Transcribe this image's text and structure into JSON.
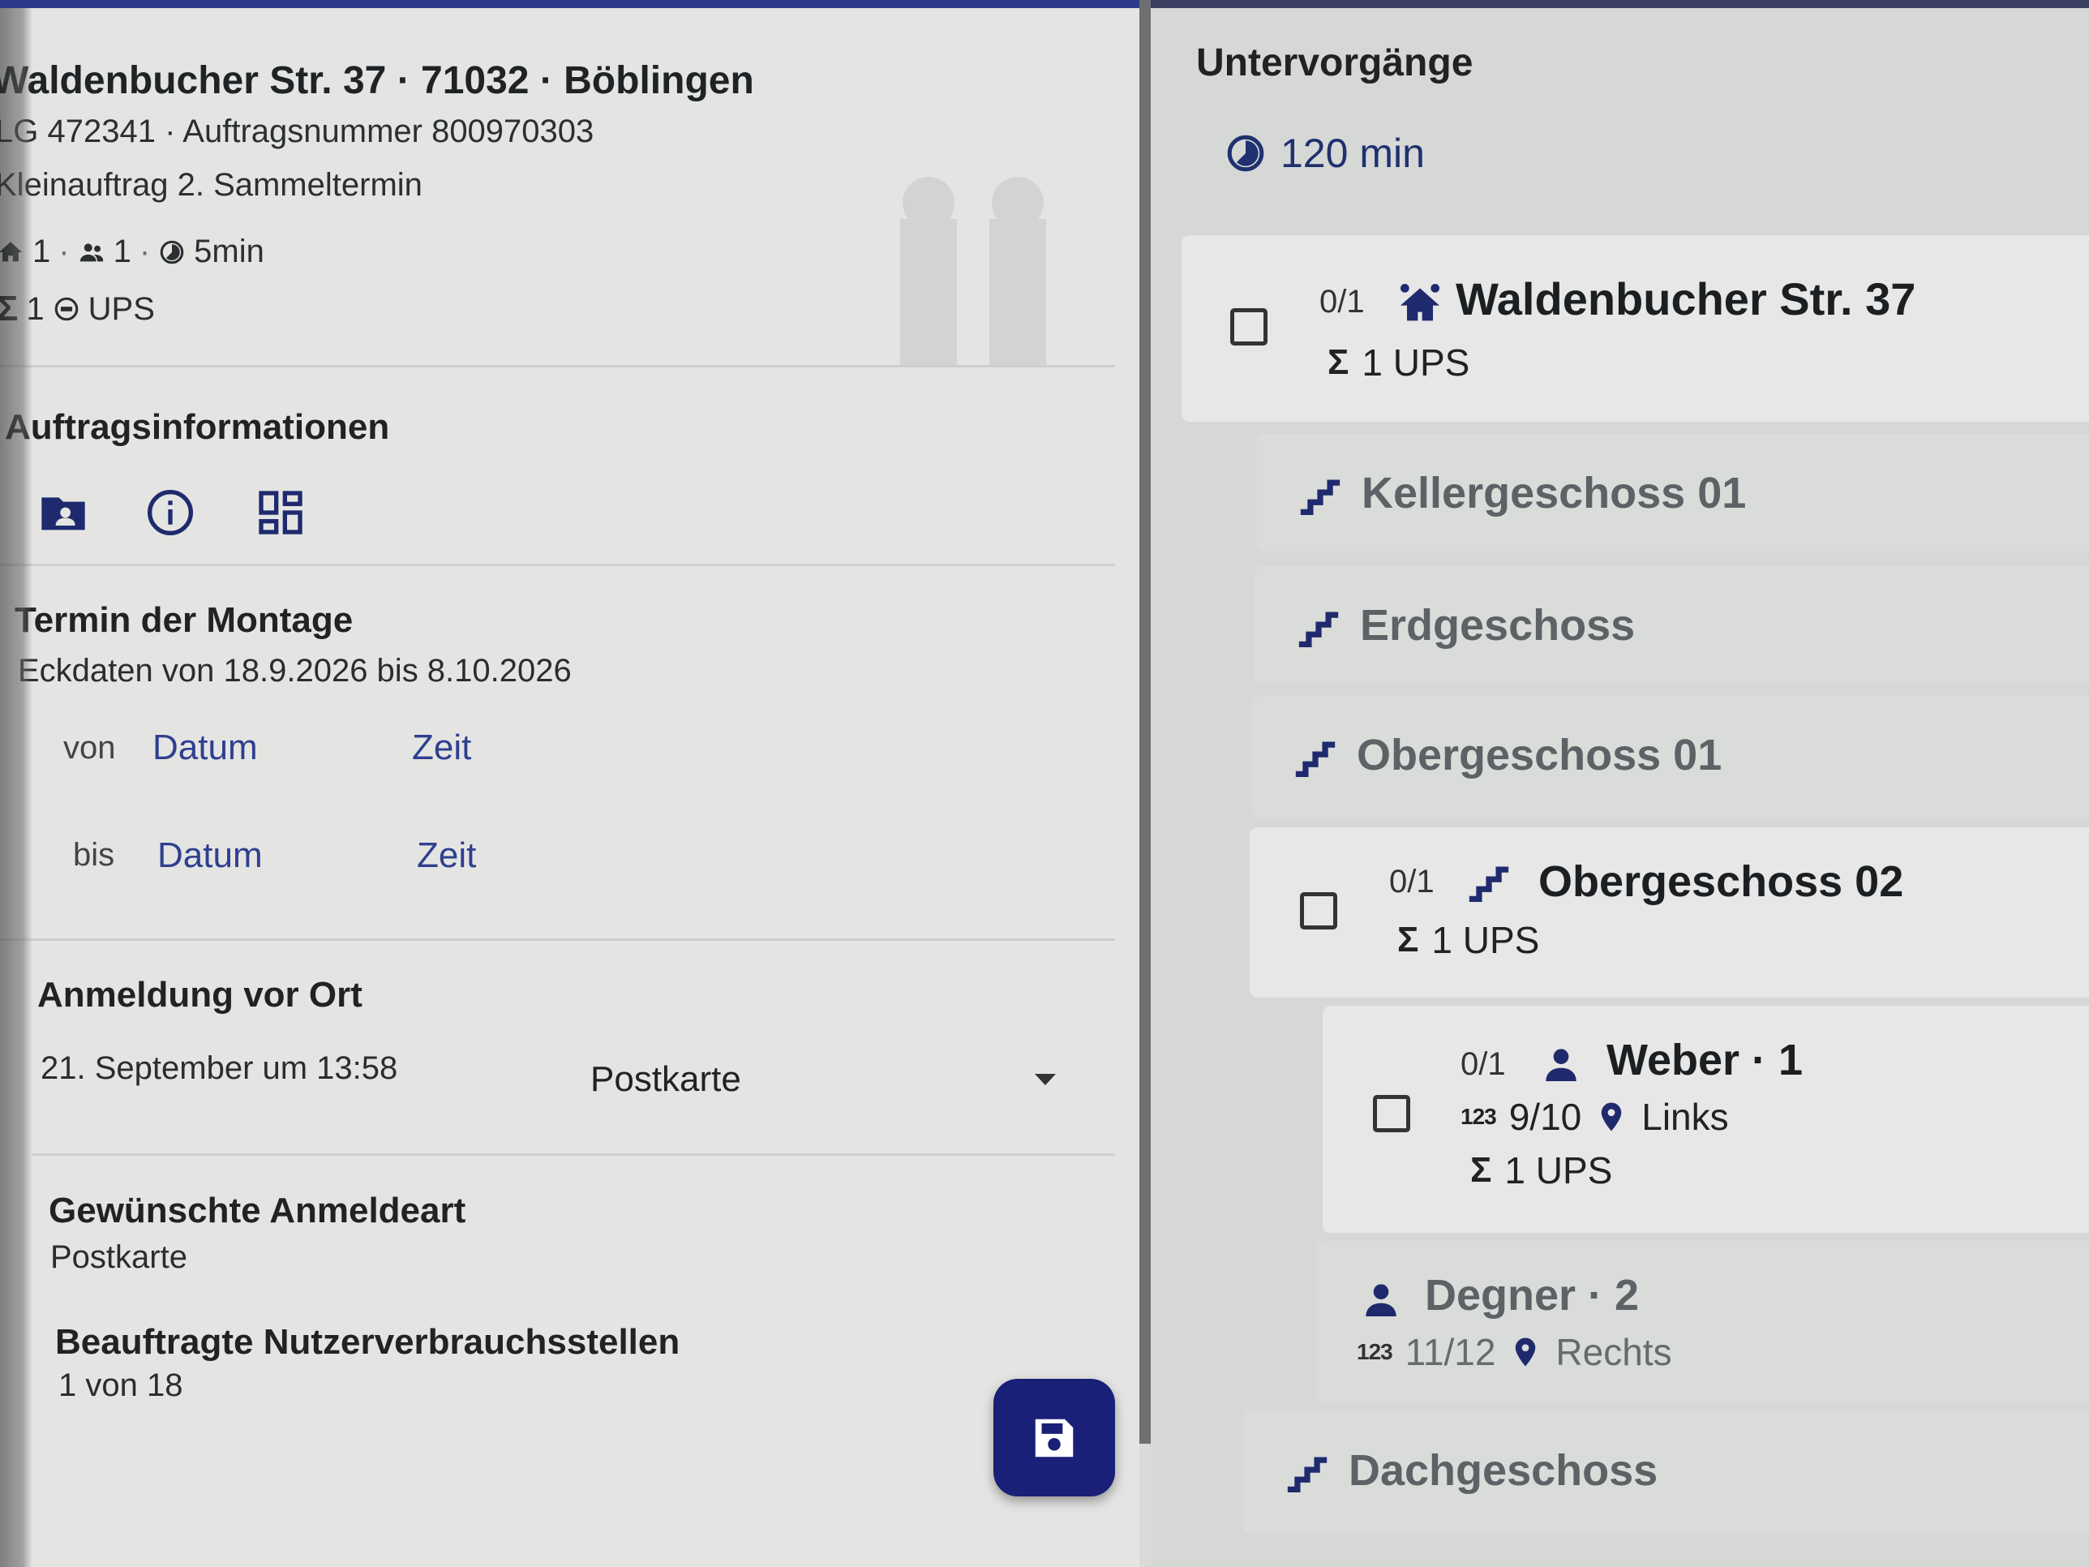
{
  "header": {
    "address": "Waldenbucher Str. 37 · 71032 · Böblingen",
    "line2": "LG 472341 · Auftragsnummer 800970303",
    "line3": "Kleinauftrag 2. Sammeltermin",
    "meta": {
      "homes": "1",
      "persons": "1",
      "duration": "5min"
    },
    "sum": {
      "count": "1",
      "unit": "UPS"
    }
  },
  "auftragsinfo": {
    "title": "Auftragsinformationen",
    "tabs": [
      "folder-account-icon",
      "info-icon",
      "dashboard-icon"
    ]
  },
  "termin": {
    "title": "Termin der Montage",
    "eckdaten": "Eckdaten von 18.9.2026 bis 8.10.2026",
    "von_label": "von",
    "bis_label": "bis",
    "datum": "Datum",
    "zeit": "Zeit"
  },
  "anmeldung": {
    "title": "Anmeldung vor Ort",
    "date": "21. September um 13:58",
    "method": "Postkarte"
  },
  "gewuenscht": {
    "title": "Gewünschte Anmeldeart",
    "value": "Postkarte"
  },
  "beauftragte": {
    "title": "Beauftragte Nutzerverbrauchsstellen",
    "value": "1 von 18"
  },
  "right": {
    "title": "Untervorgänge",
    "duration": "120 min",
    "building": {
      "count": "0/1",
      "name": "Waldenbucher Str. 37",
      "sum": "1 UPS"
    },
    "floors": {
      "keller": "Kellergeschoss 01",
      "erd": "Erdgeschoss",
      "og1": "Obergeschoss 01",
      "og2": {
        "count": "0/1",
        "name": "Obergeschoss 02",
        "sum": "1 UPS"
      },
      "dach": "Dachgeschoss"
    },
    "weber": {
      "count": "0/1",
      "name": "Weber · 1",
      "number": "9/10",
      "location": "Links",
      "sum": "1 UPS",
      "num_icon": "123"
    },
    "degner": {
      "name": "Degner · 2",
      "number": "11/12",
      "location": "Rechts",
      "num_icon": "123"
    }
  },
  "sigma": "Σ",
  "colors": {
    "accent": "#1a1f77",
    "link": "#2f3f8f"
  }
}
